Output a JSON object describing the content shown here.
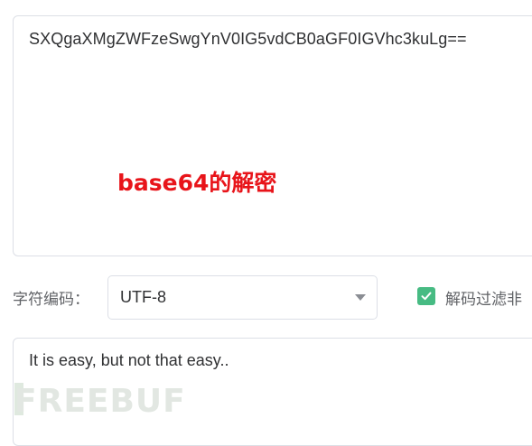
{
  "input": {
    "value": "SXQgaXMgZWFzeSwgYnV0IG5vdCB0aGF0IGVhc3kuLg=="
  },
  "annotation": {
    "text": "base64的解密"
  },
  "encoding": {
    "label": "字符编码：",
    "selected": "UTF-8"
  },
  "filter_option": {
    "label": "解码过滤非",
    "checked": true
  },
  "output": {
    "value": "It is easy, but not that easy.."
  },
  "watermark": {
    "text": "FREEBUF"
  },
  "colors": {
    "accent_green": "#47bb83",
    "annotation_red": "#e8141a",
    "border": "#dcdfe6"
  },
  "icons": {
    "caret": "caret-down-icon",
    "check": "check-icon"
  }
}
